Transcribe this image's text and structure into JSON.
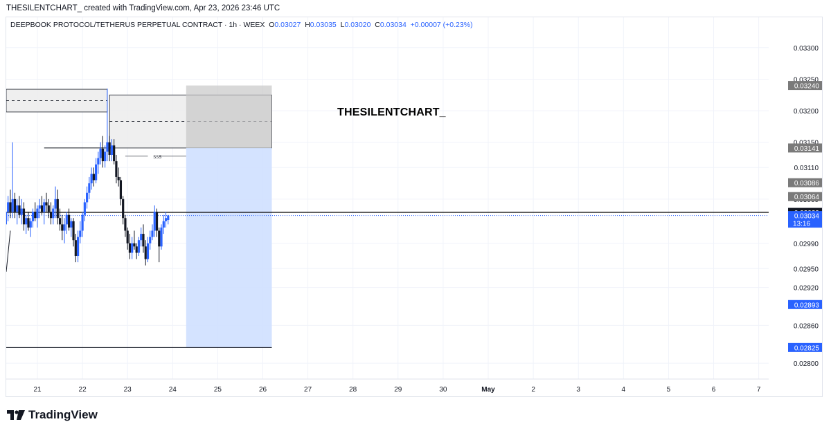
{
  "header": {
    "credit": "THESILENTCHART_ created with TradingView.com, Apr 23, 2026 23:46 UTC"
  },
  "legend": {
    "symbol": "DEEPBOOK PROTOCOL/TETHERUS PERPETUAL CONTRACT · 1h · WEEX",
    "o_label": "O",
    "o_value": "0.03027",
    "h_label": "H",
    "h_value": "0.03035",
    "l_label": "L",
    "l_value": "0.03020",
    "c_label": "C",
    "c_value": "0.03034",
    "change": "+0.00007 (+0.23%)"
  },
  "watermark": "THESILENTCHART_",
  "footer": {
    "brand": "TradingView"
  },
  "colors": {
    "up": "#2962ff",
    "down": "#131722",
    "target_zone": "#cfe0ff",
    "stop_zone": "#c8c8c8",
    "axis_text": "#131722"
  },
  "chart_data": {
    "type": "candlestick",
    "title": "DEEPBOOK PROTOCOL/TETHERUS PERPETUAL CONTRACT · 1h · WEEX",
    "ylim": [
      0.02775,
      0.03348
    ],
    "y_ticks": [
      "0.03300",
      "0.03250",
      "0.03200",
      "0.03150",
      "0.03110",
      "0.03060",
      "0.02990",
      "0.02950",
      "0.02920",
      "0.02860",
      "0.02800"
    ],
    "x_ticks": [
      "21",
      "22",
      "23",
      "24",
      "25",
      "26",
      "27",
      "28",
      "29",
      "30",
      "May",
      "2",
      "3",
      "4",
      "5",
      "6",
      "7"
    ],
    "price_labels": [
      {
        "text": "0.03240",
        "style": "gray"
      },
      {
        "text": "0.03141",
        "style": "gray"
      },
      {
        "text": "0.03086",
        "style": "gray"
      },
      {
        "text": "0.03064",
        "style": "gray"
      },
      {
        "text": "0.03039",
        "style": "black"
      },
      {
        "text": "0.03034",
        "sub": "13:16",
        "style": "blue"
      },
      {
        "text": "0.02893",
        "style": "blue"
      },
      {
        "text": "0.02825",
        "style": "blue"
      }
    ],
    "annotation": "SSS",
    "position": {
      "side": "short",
      "entry": 0.03141,
      "stop": 0.0324,
      "target": 0.02825,
      "start_day": 24.3,
      "end_day": 26.2
    },
    "supply_zones": [
      {
        "from_day": 20.0,
        "to_day": 22.55,
        "top": 0.03234,
        "bottom": 0.03198,
        "mid": 0.03216
      },
      {
        "from_day": 22.6,
        "to_day": 26.2,
        "top": 0.03225,
        "bottom": 0.03141,
        "mid": 0.03183
      }
    ],
    "key_levels": [
      {
        "price": 0.03039,
        "from_day": 20.0,
        "style": "solid",
        "color": "#000000"
      },
      {
        "price": 0.03034,
        "from_day": 20.0,
        "style": "dotted",
        "color": "#2962ff"
      },
      {
        "price": 0.03141,
        "from_day": 21.15,
        "to_day": 22.7,
        "style": "solid",
        "color": "#131722"
      },
      {
        "price": 0.02825,
        "from_day": 20.0,
        "to_day": 26.2,
        "style": "solid",
        "color": "#131722"
      }
    ],
    "candles": [
      {
        "t": 20.0,
        "o": 0.0301,
        "h": 0.0303,
        "l": 0.0299,
        "c": 0.0302
      },
      {
        "t": 20.05,
        "o": 0.0302,
        "h": 0.03045,
        "l": 0.03005,
        "c": 0.03035
      },
      {
        "t": 20.1,
        "o": 0.03035,
        "h": 0.0305,
        "l": 0.0301,
        "c": 0.03015
      },
      {
        "t": 20.15,
        "o": 0.03015,
        "h": 0.0304,
        "l": 0.03,
        "c": 0.0303
      },
      {
        "t": 20.2,
        "o": 0.0303,
        "h": 0.03065,
        "l": 0.0302,
        "c": 0.03055
      },
      {
        "t": 20.25,
        "o": 0.03055,
        "h": 0.0306,
        "l": 0.0301,
        "c": 0.0302
      },
      {
        "t": 20.3,
        "o": 0.0302,
        "h": 0.03045,
        "l": 0.03,
        "c": 0.0304
      },
      {
        "t": 20.35,
        "o": 0.0304,
        "h": 0.03065,
        "l": 0.03025,
        "c": 0.03055
      },
      {
        "t": 20.4,
        "o": 0.03055,
        "h": 0.03075,
        "l": 0.0303,
        "c": 0.0304
      },
      {
        "t": 20.45,
        "o": 0.0304,
        "h": 0.0315,
        "l": 0.0303,
        "c": 0.0306
      },
      {
        "t": 20.5,
        "o": 0.0306,
        "h": 0.0307,
        "l": 0.0303,
        "c": 0.0304
      },
      {
        "t": 20.55,
        "o": 0.0304,
        "h": 0.0306,
        "l": 0.0302,
        "c": 0.0305
      },
      {
        "t": 20.6,
        "o": 0.0305,
        "h": 0.03065,
        "l": 0.0303,
        "c": 0.03035
      },
      {
        "t": 20.65,
        "o": 0.03035,
        "h": 0.0306,
        "l": 0.0302,
        "c": 0.03045
      },
      {
        "t": 20.7,
        "o": 0.03045,
        "h": 0.03055,
        "l": 0.0301,
        "c": 0.0302
      },
      {
        "t": 20.75,
        "o": 0.0302,
        "h": 0.03035,
        "l": 0.03005,
        "c": 0.0303
      },
      {
        "t": 20.8,
        "o": 0.0303,
        "h": 0.0304,
        "l": 0.0301,
        "c": 0.03015
      },
      {
        "t": 20.85,
        "o": 0.03015,
        "h": 0.0303,
        "l": 0.03,
        "c": 0.03025
      },
      {
        "t": 20.9,
        "o": 0.03025,
        "h": 0.03045,
        "l": 0.03015,
        "c": 0.0304
      },
      {
        "t": 20.95,
        "o": 0.0304,
        "h": 0.03055,
        "l": 0.03025,
        "c": 0.0303
      },
      {
        "t": 21.0,
        "o": 0.0303,
        "h": 0.0305,
        "l": 0.03015,
        "c": 0.03045
      },
      {
        "t": 21.05,
        "o": 0.03045,
        "h": 0.0306,
        "l": 0.0303,
        "c": 0.0305
      },
      {
        "t": 21.1,
        "o": 0.0305,
        "h": 0.03065,
        "l": 0.03035,
        "c": 0.0304
      },
      {
        "t": 21.15,
        "o": 0.0304,
        "h": 0.0306,
        "l": 0.0302,
        "c": 0.03055
      },
      {
        "t": 21.2,
        "o": 0.03055,
        "h": 0.0307,
        "l": 0.0304,
        "c": 0.0305
      },
      {
        "t": 21.25,
        "o": 0.0305,
        "h": 0.0306,
        "l": 0.0303,
        "c": 0.0304
      },
      {
        "t": 21.3,
        "o": 0.0304,
        "h": 0.03055,
        "l": 0.0302,
        "c": 0.0303
      },
      {
        "t": 21.35,
        "o": 0.0303,
        "h": 0.0305,
        "l": 0.0302,
        "c": 0.03045
      },
      {
        "t": 21.4,
        "o": 0.03045,
        "h": 0.0308,
        "l": 0.0303,
        "c": 0.0306
      },
      {
        "t": 21.45,
        "o": 0.0306,
        "h": 0.03075,
        "l": 0.0302,
        "c": 0.0303
      },
      {
        "t": 21.5,
        "o": 0.0303,
        "h": 0.03045,
        "l": 0.0301,
        "c": 0.0302
      },
      {
        "t": 21.55,
        "o": 0.0302,
        "h": 0.03035,
        "l": 0.02995,
        "c": 0.0301
      },
      {
        "t": 21.6,
        "o": 0.0301,
        "h": 0.0303,
        "l": 0.0299,
        "c": 0.0302
      },
      {
        "t": 21.65,
        "o": 0.0302,
        "h": 0.0304,
        "l": 0.03005,
        "c": 0.03035
      },
      {
        "t": 21.7,
        "o": 0.03035,
        "h": 0.03045,
        "l": 0.0301,
        "c": 0.03015
      },
      {
        "t": 21.75,
        "o": 0.03015,
        "h": 0.0303,
        "l": 0.03,
        "c": 0.03025
      },
      {
        "t": 21.8,
        "o": 0.03025,
        "h": 0.0303,
        "l": 0.02985,
        "c": 0.02995
      },
      {
        "t": 21.85,
        "o": 0.02995,
        "h": 0.03005,
        "l": 0.0296,
        "c": 0.0297
      },
      {
        "t": 21.9,
        "o": 0.0297,
        "h": 0.0301,
        "l": 0.0296,
        "c": 0.03
      },
      {
        "t": 21.95,
        "o": 0.03,
        "h": 0.03025,
        "l": 0.0299,
        "c": 0.0301
      },
      {
        "t": 22.0,
        "o": 0.0301,
        "h": 0.0304,
        "l": 0.03,
        "c": 0.03035
      },
      {
        "t": 22.05,
        "o": 0.03035,
        "h": 0.0306,
        "l": 0.03025,
        "c": 0.03055
      },
      {
        "t": 22.1,
        "o": 0.03055,
        "h": 0.0308,
        "l": 0.03045,
        "c": 0.0307
      },
      {
        "t": 22.15,
        "o": 0.0307,
        "h": 0.03095,
        "l": 0.0306,
        "c": 0.03085
      },
      {
        "t": 22.2,
        "o": 0.03085,
        "h": 0.0311,
        "l": 0.03075,
        "c": 0.031
      },
      {
        "t": 22.25,
        "o": 0.031,
        "h": 0.0311,
        "l": 0.0308,
        "c": 0.0309
      },
      {
        "t": 22.3,
        "o": 0.0309,
        "h": 0.03125,
        "l": 0.03085,
        "c": 0.03115
      },
      {
        "t": 22.35,
        "o": 0.03115,
        "h": 0.03135,
        "l": 0.031,
        "c": 0.03125
      },
      {
        "t": 22.4,
        "o": 0.03125,
        "h": 0.0315,
        "l": 0.03115,
        "c": 0.0314
      },
      {
        "t": 22.45,
        "o": 0.0314,
        "h": 0.0316,
        "l": 0.0311,
        "c": 0.0312
      },
      {
        "t": 22.5,
        "o": 0.0312,
        "h": 0.03145,
        "l": 0.0311,
        "c": 0.03135
      },
      {
        "t": 22.55,
        "o": 0.03135,
        "h": 0.03235,
        "l": 0.0312,
        "c": 0.0315
      },
      {
        "t": 22.6,
        "o": 0.0315,
        "h": 0.0316,
        "l": 0.0312,
        "c": 0.0313
      },
      {
        "t": 22.65,
        "o": 0.0313,
        "h": 0.03155,
        "l": 0.0312,
        "c": 0.03145
      },
      {
        "t": 22.7,
        "o": 0.03145,
        "h": 0.03155,
        "l": 0.03115,
        "c": 0.0312
      },
      {
        "t": 22.75,
        "o": 0.0312,
        "h": 0.0313,
        "l": 0.03085,
        "c": 0.03095
      },
      {
        "t": 22.8,
        "o": 0.03095,
        "h": 0.0311,
        "l": 0.0308,
        "c": 0.0309
      },
      {
        "t": 22.85,
        "o": 0.0309,
        "h": 0.03095,
        "l": 0.0305,
        "c": 0.0306
      },
      {
        "t": 22.9,
        "o": 0.0306,
        "h": 0.03065,
        "l": 0.0302,
        "c": 0.0303
      },
      {
        "t": 22.95,
        "o": 0.0303,
        "h": 0.03035,
        "l": 0.03,
        "c": 0.0301
      },
      {
        "t": 23.0,
        "o": 0.0301,
        "h": 0.03015,
        "l": 0.0298,
        "c": 0.0299
      },
      {
        "t": 23.05,
        "o": 0.0299,
        "h": 0.03005,
        "l": 0.02965,
        "c": 0.02975
      },
      {
        "t": 23.1,
        "o": 0.02975,
        "h": 0.03,
        "l": 0.02965,
        "c": 0.0299
      },
      {
        "t": 23.15,
        "o": 0.0299,
        "h": 0.0301,
        "l": 0.0298,
        "c": 0.02985
      },
      {
        "t": 23.2,
        "o": 0.02985,
        "h": 0.0299,
        "l": 0.02965,
        "c": 0.02975
      },
      {
        "t": 23.25,
        "o": 0.02975,
        "h": 0.03,
        "l": 0.0297,
        "c": 0.02995
      },
      {
        "t": 23.3,
        "o": 0.02995,
        "h": 0.03015,
        "l": 0.02985,
        "c": 0.03005
      },
      {
        "t": 23.35,
        "o": 0.03005,
        "h": 0.0302,
        "l": 0.02975,
        "c": 0.02985
      },
      {
        "t": 23.4,
        "o": 0.02985,
        "h": 0.02995,
        "l": 0.02955,
        "c": 0.02965
      },
      {
        "t": 23.45,
        "o": 0.02965,
        "h": 0.03,
        "l": 0.0296,
        "c": 0.0299
      },
      {
        "t": 23.5,
        "o": 0.0299,
        "h": 0.0301,
        "l": 0.0298,
        "c": 0.03
      },
      {
        "t": 23.55,
        "o": 0.03,
        "h": 0.0302,
        "l": 0.02995,
        "c": 0.0301
      },
      {
        "t": 23.6,
        "o": 0.0301,
        "h": 0.0305,
        "l": 0.03,
        "c": 0.0304
      },
      {
        "t": 23.65,
        "o": 0.0304,
        "h": 0.03045,
        "l": 0.03,
        "c": 0.0301
      },
      {
        "t": 23.7,
        "o": 0.0301,
        "h": 0.03015,
        "l": 0.0296,
        "c": 0.02985
      },
      {
        "t": 23.75,
        "o": 0.02985,
        "h": 0.0302,
        "l": 0.0298,
        "c": 0.03015
      },
      {
        "t": 23.8,
        "o": 0.03015,
        "h": 0.03035,
        "l": 0.03005,
        "c": 0.03025
      },
      {
        "t": 23.85,
        "o": 0.03025,
        "h": 0.0304,
        "l": 0.03015,
        "c": 0.0303
      },
      {
        "t": 23.9,
        "o": 0.03027,
        "h": 0.03035,
        "l": 0.0302,
        "c": 0.03034
      }
    ]
  }
}
